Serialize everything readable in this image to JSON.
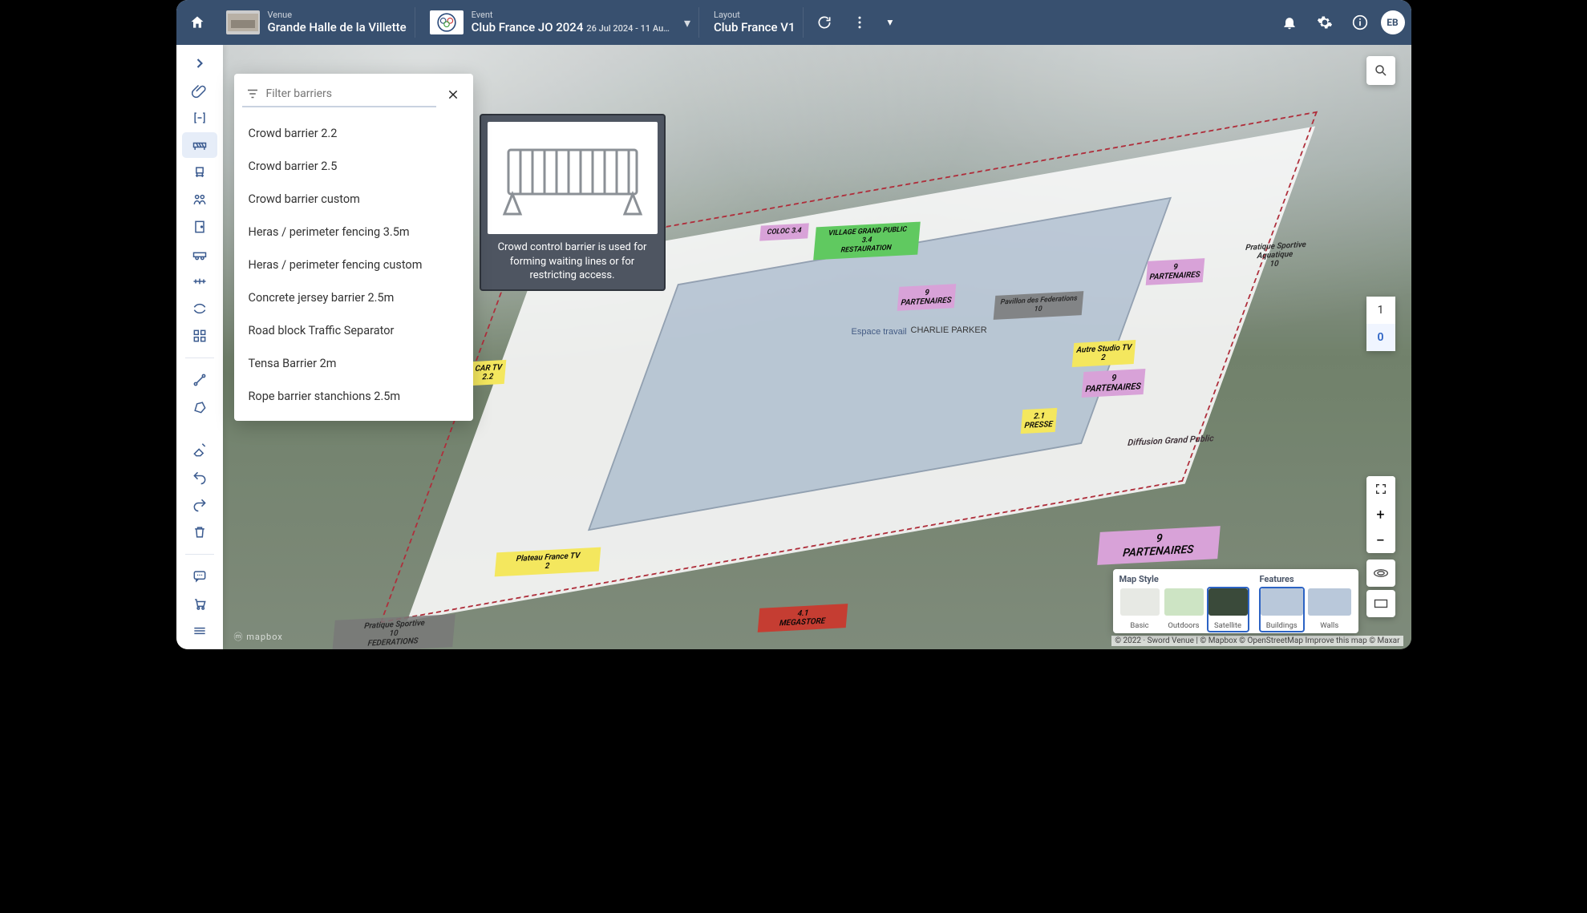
{
  "header": {
    "venue_label": "Venue",
    "venue_name": "Grande Halle de la Villette",
    "event_label": "Event",
    "event_name": "Club France JO 2024",
    "event_dates": "26 Jul 2024 - 11 Au…",
    "layout_label": "Layout",
    "layout_name": "Club France V1",
    "user_initials": "EB"
  },
  "search_placeholder": "Search",
  "barrier_panel": {
    "filter_placeholder": "Filter barriers",
    "items": [
      "Crowd barrier 2.2",
      "Crowd barrier 2.5",
      "Crowd barrier custom",
      "Heras / perimeter fencing 3.5m",
      "Heras / perimeter fencing custom",
      "Concrete jersey barrier 2.5m",
      "Road block Traffic Separator",
      "Tensa Barrier 2m",
      "Rope barrier stanchions 2.5m"
    ]
  },
  "tooltip": {
    "text": "Crowd control barrier is used for forming waiting lines or for restricting access."
  },
  "floors": {
    "levels": [
      "1",
      "0"
    ],
    "active": "0"
  },
  "map_style_panel": {
    "style_heading": "Map Style",
    "features_heading": "Features",
    "styles": [
      "Basic",
      "Outdoors",
      "Satellite"
    ],
    "active_style": "Satellite",
    "features": [
      "Buildings",
      "Walls"
    ],
    "active_feature": "Buildings"
  },
  "zones": {
    "car_tv": {
      "label": "CAR TV",
      "sub": "2.2"
    },
    "plateau": {
      "label": "Plateau France TV",
      "sub": "2"
    },
    "megastore": {
      "label": "4.1",
      "sub": "MEGASTORE"
    },
    "partenaires_s": {
      "label": "9",
      "sub": "PARTENAIRES"
    },
    "partenaires_n": {
      "label": "9",
      "sub": "PARTENAIRES"
    },
    "partenaires_e": {
      "label": "9",
      "sub": "PARTENAIRES"
    },
    "partenaires_ne": {
      "label": "9",
      "sub": "PARTENAIRES"
    },
    "presse": {
      "label": "2.1",
      "sub": "PRESSE"
    },
    "studio": {
      "label": "Autre Studio TV",
      "sub": "2"
    },
    "federations": {
      "label": "Pratique Sportive",
      "sub1": "10",
      "sub2": "FEDERATIONS"
    },
    "cuisine": {
      "label": "COLOC",
      "sub": "3.4"
    },
    "village": {
      "label": "VILLAGE GRAND PUBLIC",
      "sub1": "3.4",
      "sub2": "RESTAURATION"
    },
    "diffusion": {
      "label": "Diffusion Grand Public"
    },
    "pratique_e": {
      "label": "Pratique Sportive",
      "sub1": "Aquatique",
      "sub2": "10"
    },
    "pavillon": {
      "label": "Pavillon des Federations",
      "sub": "10"
    },
    "interior1": {
      "label": "Espace travail"
    },
    "interior2": {
      "label": "CHARLIE PARKER"
    }
  },
  "attribution": "© 2022 · Sword Venue | © Mapbox © OpenStreetMap  Improve this map  © Maxar",
  "mapbox_logo": "ⓜ mapbox"
}
